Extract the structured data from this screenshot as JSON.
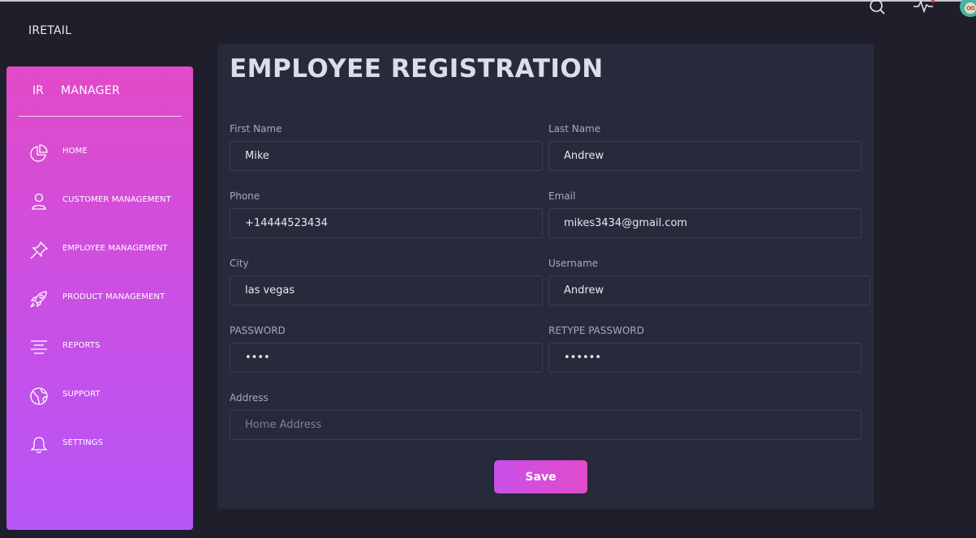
{
  "brand": "IRETAIL",
  "sidebar": {
    "mini": "IR",
    "title": "MANAGER",
    "items": [
      {
        "label": "HOME",
        "icon": "pie-chart-icon"
      },
      {
        "label": "CUSTOMER MANAGEMENT",
        "icon": "user-icon"
      },
      {
        "label": "EMPLOYEE MANAGEMENT",
        "icon": "pin-icon"
      },
      {
        "label": "PRODUCT MANAGEMENT",
        "icon": "rocket-icon"
      },
      {
        "label": "REPORTS",
        "icon": "align-center-icon"
      },
      {
        "label": "SUPPORT",
        "icon": "globe-icon"
      },
      {
        "label": "SETTINGS",
        "icon": "bell-icon"
      }
    ]
  },
  "form": {
    "title": "EMPLOYEE REGISTRATION",
    "first_name": {
      "label": "First Name",
      "value": "Mike"
    },
    "last_name": {
      "label": "Last Name",
      "value": "Andrew"
    },
    "phone": {
      "label": "Phone",
      "value": "+14444523434"
    },
    "email": {
      "label": "Email",
      "value": "mikes3434@gmail.com"
    },
    "city": {
      "label": "City",
      "value": "las vegas"
    },
    "username": {
      "label": "Username",
      "value": "Andrew"
    },
    "password": {
      "label": "PASSWORD",
      "value": "abcd"
    },
    "retype_password": {
      "label": "RETYPE PASSWORD",
      "value": "abcdef"
    },
    "address": {
      "label": "Address",
      "value": "",
      "placeholder": "Home Address"
    },
    "save_label": "Save"
  },
  "topbar": {
    "icons": [
      "search-icon",
      "activity-icon",
      "avatar"
    ]
  },
  "colors": {
    "background": "#1f1f2b",
    "card": "#272a3a",
    "sidebar_top": "#e24ac7",
    "sidebar_bottom": "#b655f6",
    "button": "#d64ed9"
  }
}
